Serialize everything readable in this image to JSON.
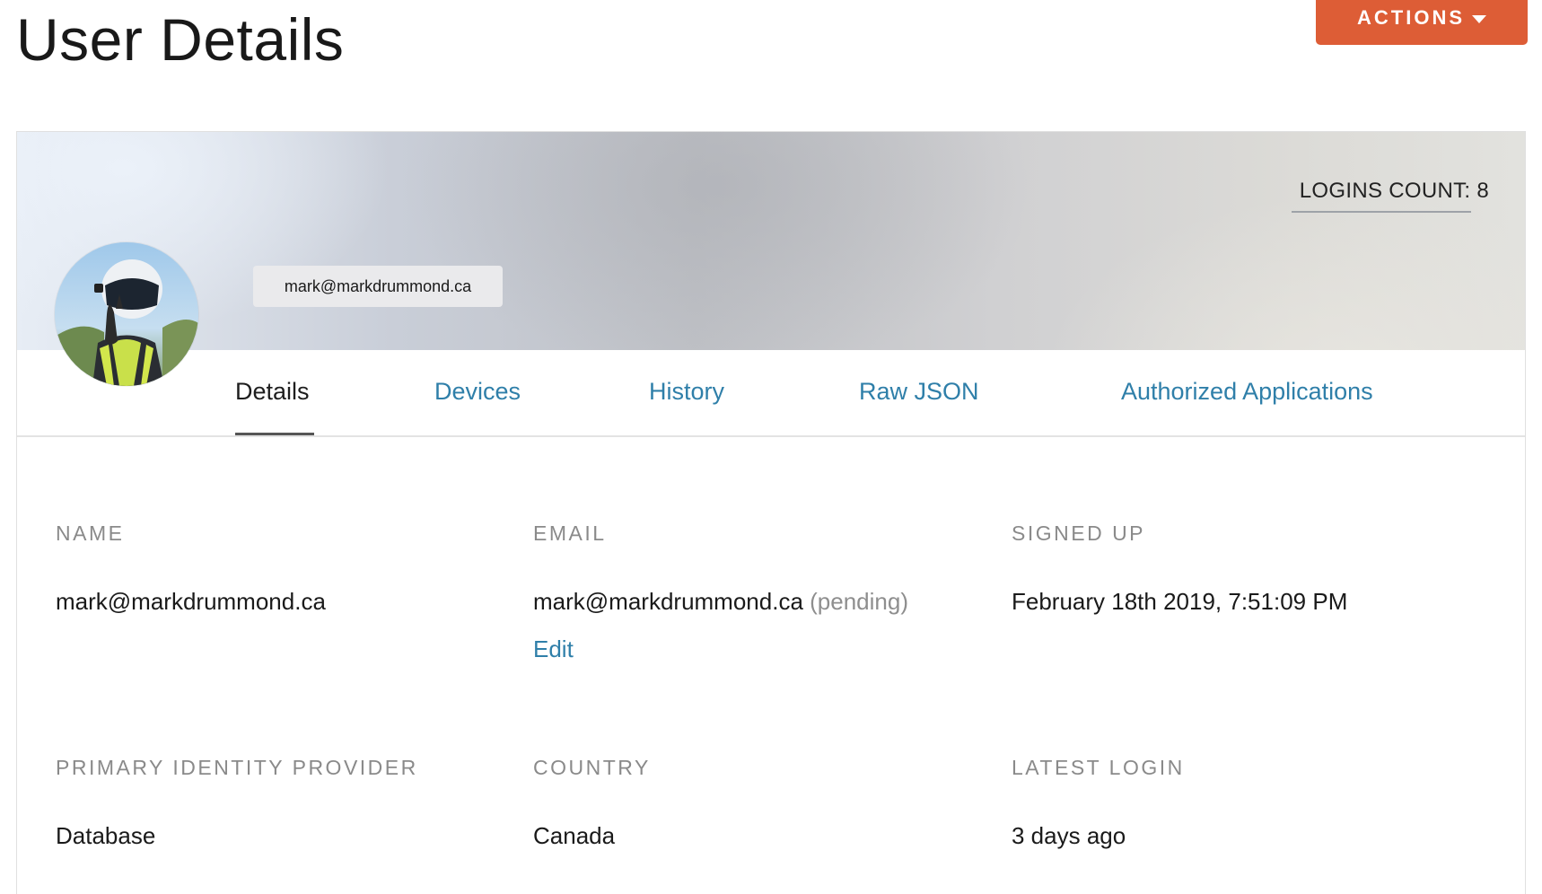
{
  "header": {
    "title": "User Details",
    "actions_label": "ACTIONS"
  },
  "profile": {
    "logins_count_label": "LOGINS COUNT:",
    "logins_count": "8",
    "email_chip": "mark@markdrummond.ca"
  },
  "tabs": [
    {
      "label": "Details",
      "active": true
    },
    {
      "label": "Devices",
      "active": false
    },
    {
      "label": "History",
      "active": false
    },
    {
      "label": "Raw JSON",
      "active": false
    },
    {
      "label": "Authorized Applications",
      "active": false
    }
  ],
  "details": {
    "name": {
      "label": "NAME",
      "value": "mark@markdrummond.ca"
    },
    "email": {
      "label": "EMAIL",
      "value": "mark@markdrummond.ca",
      "status": "(pending)",
      "edit_label": "Edit"
    },
    "signed_up": {
      "label": "SIGNED UP",
      "value": "February 18th 2019, 7:51:09 PM"
    },
    "primary_identity_provider": {
      "label": "PRIMARY IDENTITY PROVIDER",
      "value": "Database"
    },
    "country": {
      "label": "COUNTRY",
      "value": "Canada"
    },
    "latest_login": {
      "label": "LATEST LOGIN",
      "value": "3 days ago"
    }
  },
  "colors": {
    "accent": "#dd5d36",
    "link": "#2f7fa9",
    "label_gray": "#8a8a8a"
  },
  "icons": {
    "actions_caret": "chevron-down-icon"
  }
}
